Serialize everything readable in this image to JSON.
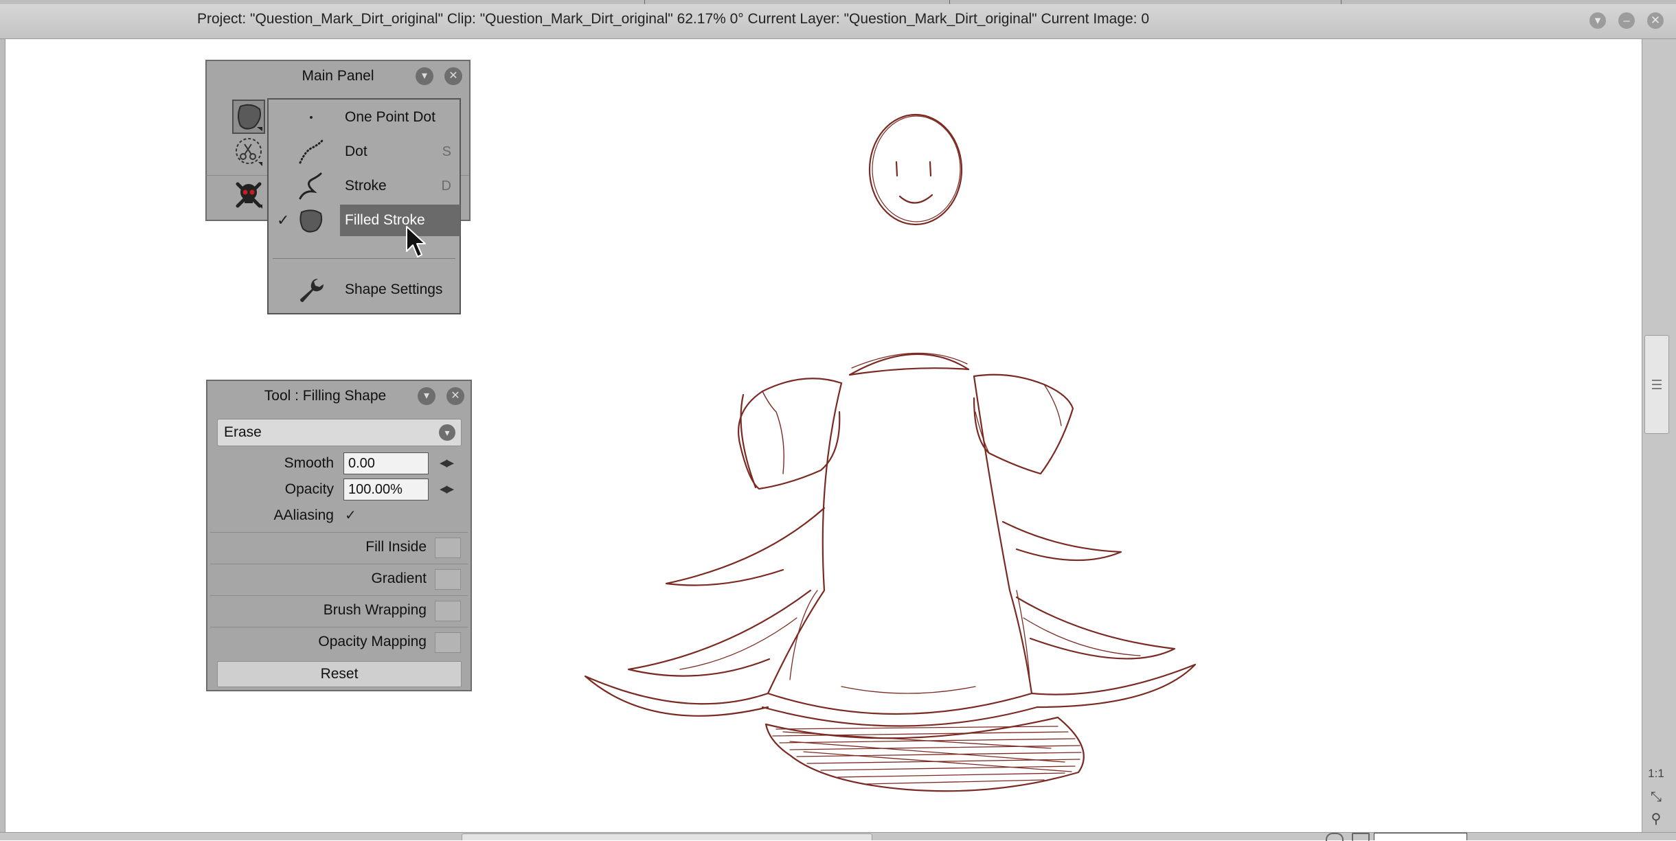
{
  "window": {
    "title": "Project:  \"Question_Mark_Dirt_original\"  Clip: \"Question_Mark_Dirt_original\"   62.17%   0°  Current Layer: \"Question_Mark_Dirt_original\"  Current Image: 0",
    "buttons": [
      "minimize-icon",
      "maximize-icon",
      "close-icon"
    ]
  },
  "main_panel": {
    "title": "Main Panel",
    "tools": [
      "filled-stroke-tool-icon",
      "selection-scissors-icon",
      "skull-crossbones-icon"
    ]
  },
  "shape_menu": {
    "items": [
      {
        "label": "One Point Dot",
        "shortcut": "",
        "icon": "one-point-dot-icon"
      },
      {
        "label": "Dot",
        "shortcut": "S",
        "icon": "dot-icon"
      },
      {
        "label": "Stroke",
        "shortcut": "D",
        "icon": "stroke-icon"
      },
      {
        "label": "Filled Stroke",
        "shortcut": "",
        "icon": "filled-stroke-icon",
        "checked": true,
        "highlighted": true
      }
    ],
    "settings_label": "Shape Settings"
  },
  "tool_panel": {
    "title": "Tool : Filling Shape",
    "mode": "Erase",
    "smooth_label": "Smooth",
    "smooth_value": "0.00",
    "opacity_label": "Opacity",
    "opacity_value": "100.00%",
    "aliasing_label": "AAliasing",
    "aliasing_checked": true,
    "sections": [
      "Fill Inside",
      "Gradient",
      "Brush Wrapping",
      "Opacity Mapping"
    ],
    "reset_label": "Reset"
  },
  "side_controls": {
    "one_to_one": "1:1"
  },
  "colors": {
    "sketch_stroke": "#7a2a22",
    "panel_bg": "#a6a6a6",
    "menu_highlight": "#6a6a6a"
  }
}
